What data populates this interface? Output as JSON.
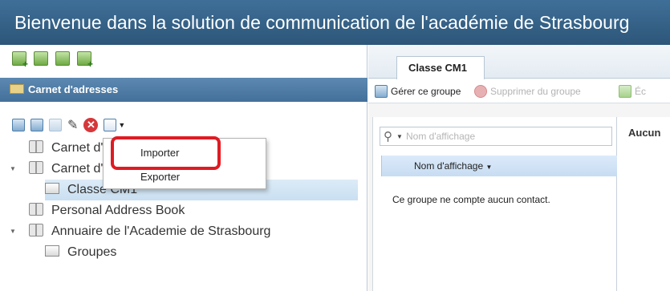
{
  "window": {
    "title": "Bienvenue dans la solution de communication de l'académie de Strasbourg"
  },
  "top_toolbar": {
    "icons": [
      "add-contact-icon",
      "add-group-icon",
      "move-contact-icon",
      "import-contact-icon"
    ]
  },
  "address_panel": {
    "header": "Carnet d'adresses",
    "toolbar_icons": [
      "add-contact-icon",
      "add-contact-alt-icon",
      "add-contact-disabled-icon",
      "edit-pencil-icon",
      "delete-icon",
      "import-export-menu-icon"
    ]
  },
  "tree": {
    "items": [
      {
        "label": "Carnet d'a",
        "indent": 1,
        "expanded": null,
        "icon": "book-icon"
      },
      {
        "label": "Carnet d'ad",
        "indent": 1,
        "expanded": true,
        "icon": "book-icon"
      },
      {
        "label": "Classe CM1",
        "indent": 2,
        "expanded": null,
        "icon": "group-icon",
        "selected": true
      },
      {
        "label": "Personal Address Book",
        "indent": 1,
        "expanded": null,
        "icon": "book-icon"
      },
      {
        "label": "Annuaire de l'Academie de Strasbourg",
        "indent": 1,
        "expanded": true,
        "icon": "book-icon"
      },
      {
        "label": "Groupes",
        "indent": 2,
        "expanded": null,
        "icon": "group-icon"
      }
    ]
  },
  "menu": {
    "items": [
      "Importer",
      "Exporter"
    ],
    "highlighted": "Importer"
  },
  "right": {
    "tab": "Classe CM1",
    "toolbar": {
      "manage": "Gérer ce groupe",
      "remove": "Supprimer du groupe",
      "write": "Éc"
    },
    "search_placeholder": "Nom d'affichage",
    "column_header": "Nom d'affichage",
    "empty_message": "Ce groupe ne compte aucun contact.",
    "details_text": "Aucun"
  },
  "colors": {
    "title_bar": "#2d5679",
    "section_bar": "#43709a",
    "highlight_frame": "#e01b23",
    "selected_row": "#c9dff1"
  }
}
